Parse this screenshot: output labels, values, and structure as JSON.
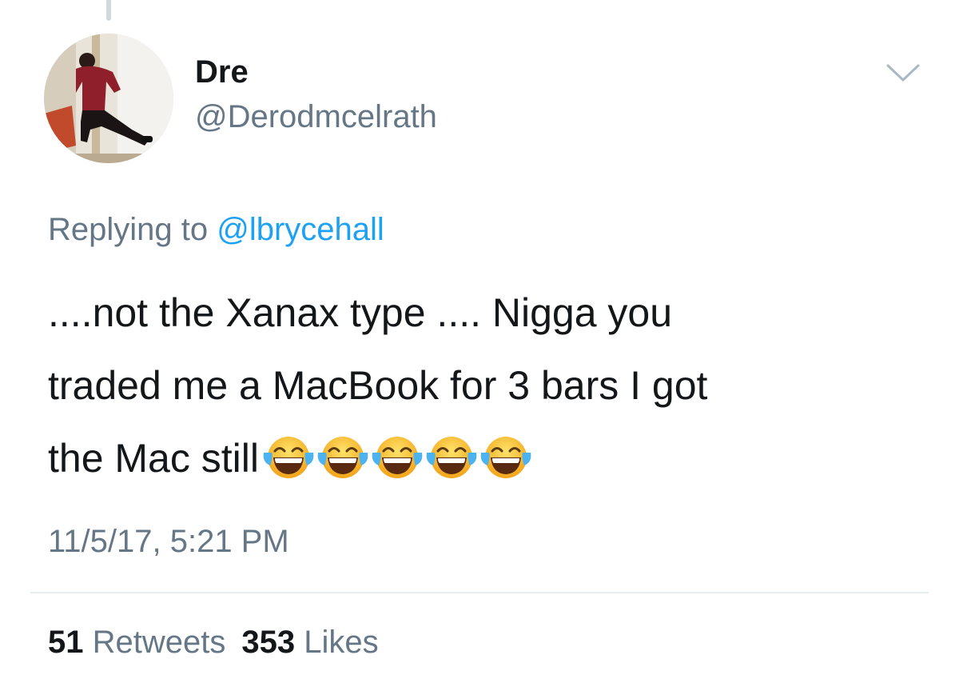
{
  "tweet": {
    "display_name": "Dre",
    "handle": "@Derodmcelrath",
    "replying_to_prefix": "Replying to",
    "replying_to_user": "@lbrycehall",
    "text_lines": [
      "....not the Xanax type .... Nigga you",
      "traded me a MacBook for 3 bars I got",
      "the Mac still"
    ],
    "emoji": [
      "😂",
      "😂",
      "😂",
      "😂",
      "😂"
    ],
    "timestamp": "11/5/17, 5:21 PM"
  },
  "stats": {
    "retweets_count": "51",
    "retweets_label": "Retweets",
    "likes_count": "353",
    "likes_label": "Likes"
  },
  "icons": {
    "caret": "chevron-down-icon",
    "emoji": "face-with-tears-of-joy-icon"
  },
  "colors": {
    "name": "#14171a",
    "secondary": "#657786",
    "link": "#1da1f2",
    "divider": "#e6ecf0"
  }
}
